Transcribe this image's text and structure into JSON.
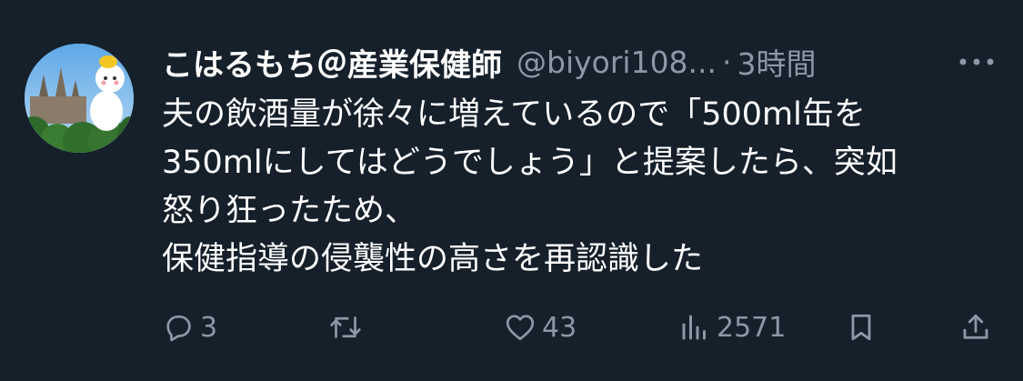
{
  "tweet": {
    "display_name": "こはるもち＠産業保健師",
    "handle": "@biyori108...",
    "separator": "·",
    "time": "3時間",
    "body_lines": [
      "夫の飲酒量が徐々に増えているので「500ml缶を",
      "350mlにしてはどうでしょう」と提案したら、突如",
      "怒り狂ったため、",
      "保健指導の侵襲性の高さを再認識した"
    ],
    "actions": {
      "reply_count": "3",
      "retweet_count": "",
      "like_count": "43",
      "view_count": "2571"
    }
  },
  "icons": [
    "more-icon",
    "reply-icon",
    "retweet-icon",
    "like-icon",
    "views-icon",
    "bookmark-icon",
    "share-icon"
  ],
  "colors": {
    "background": "#15202b",
    "primary_text": "#ffffff",
    "secondary_text": "#8b98a5"
  }
}
